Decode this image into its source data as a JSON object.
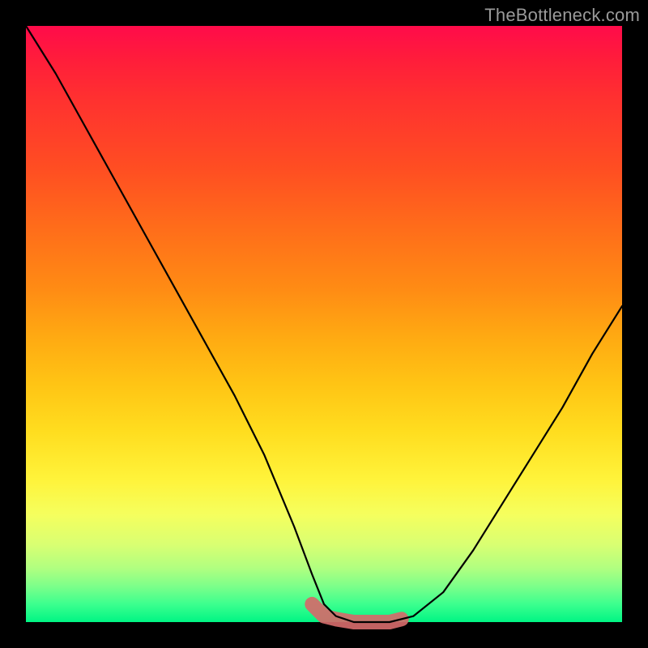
{
  "watermark": "TheBottleneck.com",
  "chart_data": {
    "type": "line",
    "title": "",
    "xlabel": "",
    "ylabel": "",
    "xlim": [
      0,
      100
    ],
    "ylim": [
      0,
      100
    ],
    "series": [
      {
        "name": "bottleneck-curve",
        "x": [
          0,
          5,
          10,
          15,
          20,
          25,
          30,
          35,
          40,
          45,
          48,
          50,
          52,
          55,
          58,
          61,
          65,
          70,
          75,
          80,
          85,
          90,
          95,
          100
        ],
        "values": [
          100,
          92,
          83,
          74,
          65,
          56,
          47,
          38,
          28,
          16,
          8,
          3,
          1,
          0,
          0,
          0,
          1,
          5,
          12,
          20,
          28,
          36,
          45,
          53
        ]
      }
    ],
    "highlight_band": {
      "name": "optimal-range",
      "x": [
        48,
        50,
        52,
        55,
        58,
        61,
        63
      ],
      "values": [
        3,
        1,
        0.5,
        0,
        0,
        0,
        0.5
      ]
    },
    "background_gradient": {
      "top": "#ff0b4a",
      "bottom": "#00f584"
    }
  }
}
